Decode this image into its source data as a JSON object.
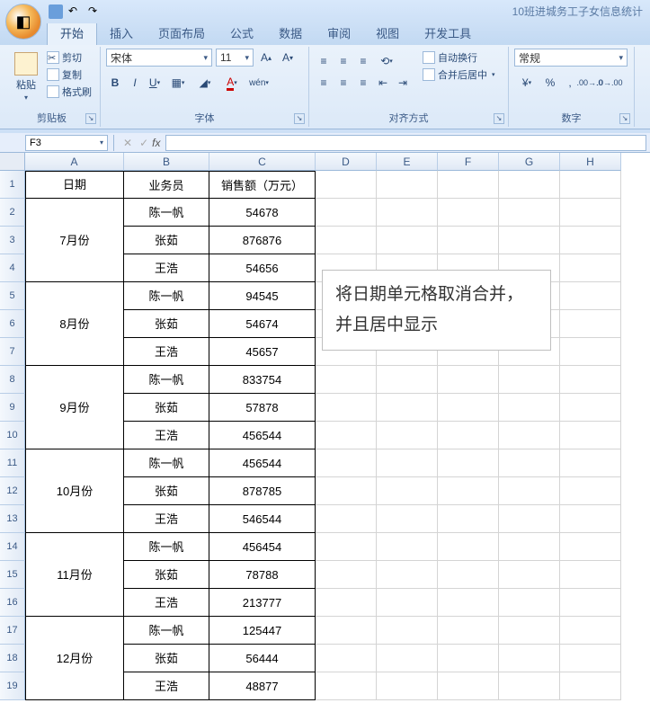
{
  "window": {
    "title": "10班进城务工子女信息统计"
  },
  "tabs": [
    "开始",
    "插入",
    "页面布局",
    "公式",
    "数据",
    "审阅",
    "视图",
    "开发工具"
  ],
  "activeTab": 0,
  "ribbon": {
    "clipboard": {
      "label": "剪贴板",
      "paste": "粘贴",
      "cut": "剪切",
      "copy": "复制",
      "fmtPainter": "格式刷"
    },
    "font": {
      "label": "字体",
      "name": "宋体",
      "size": "11"
    },
    "align": {
      "label": "对齐方式",
      "wrap": "自动换行",
      "merge": "合并后居中"
    },
    "number": {
      "label": "数字",
      "format": "常规"
    }
  },
  "nameBox": "F3",
  "colHeaders": [
    "A",
    "B",
    "C",
    "D",
    "E",
    "F",
    "G",
    "H"
  ],
  "rowCount": 19,
  "table": {
    "headers": {
      "date": "日期",
      "sales": "业务员",
      "amount": "销售额（万元）"
    },
    "months": [
      {
        "name": "7月份",
        "rows": [
          {
            "s": "陈一帆",
            "a": "54678"
          },
          {
            "s": "张茹",
            "a": "876876"
          },
          {
            "s": "王浩",
            "a": "54656"
          }
        ]
      },
      {
        "name": "8月份",
        "rows": [
          {
            "s": "陈一帆",
            "a": "94545"
          },
          {
            "s": "张茹",
            "a": "54674"
          },
          {
            "s": "王浩",
            "a": "45657"
          }
        ]
      },
      {
        "name": "9月份",
        "rows": [
          {
            "s": "陈一帆",
            "a": "833754"
          },
          {
            "s": "张茹",
            "a": "57878"
          },
          {
            "s": "王浩",
            "a": "456544"
          }
        ]
      },
      {
        "name": "10月份",
        "rows": [
          {
            "s": "陈一帆",
            "a": "456544"
          },
          {
            "s": "张茹",
            "a": "878785"
          },
          {
            "s": "王浩",
            "a": "546544"
          }
        ]
      },
      {
        "name": "11月份",
        "rows": [
          {
            "s": "陈一帆",
            "a": "456454"
          },
          {
            "s": "张茹",
            "a": "78788"
          },
          {
            "s": "王浩",
            "a": "213777"
          }
        ]
      },
      {
        "name": "12月份",
        "rows": [
          {
            "s": "陈一帆",
            "a": "125447"
          },
          {
            "s": "张茹",
            "a": "56444"
          },
          {
            "s": "王浩",
            "a": "48877"
          }
        ]
      }
    ]
  },
  "textbox": "将日期单元格取消合并，并且居中显示"
}
